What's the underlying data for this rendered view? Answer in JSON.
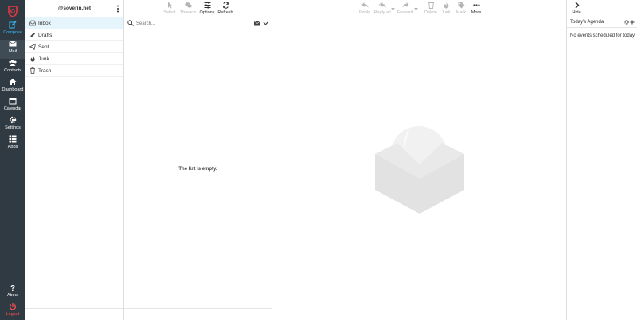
{
  "nav": {
    "items": [
      {
        "label": "Compose",
        "icon": "compose-icon"
      },
      {
        "label": "Mail",
        "icon": "mail-icon"
      },
      {
        "label": "Contacts",
        "icon": "contacts-icon"
      },
      {
        "label": "Dashboard",
        "icon": "home-icon"
      },
      {
        "label": "Calendar",
        "icon": "calendar-icon"
      },
      {
        "label": "Settings",
        "icon": "gear-icon"
      },
      {
        "label": "Apps",
        "icon": "grid-icon"
      },
      {
        "label": "About",
        "icon": "question-icon"
      },
      {
        "label": "Logout",
        "icon": "power-icon"
      }
    ],
    "active": "Mail",
    "accent_color": "#37beff",
    "logout_color": "#ff5252"
  },
  "folders": {
    "account": "@soverin.net",
    "items": [
      {
        "label": "Inbox",
        "icon": "inbox-icon"
      },
      {
        "label": "Drafts",
        "icon": "pencil-icon"
      },
      {
        "label": "Sent",
        "icon": "paper-plane-icon"
      },
      {
        "label": "Junk",
        "icon": "fire-icon"
      },
      {
        "label": "Trash",
        "icon": "trash-icon"
      }
    ],
    "selected": "Inbox"
  },
  "list": {
    "toolbar": [
      {
        "label": "Select",
        "icon": "pointer-icon",
        "enabled": false
      },
      {
        "label": "Threads",
        "icon": "comments-icon",
        "enabled": false
      },
      {
        "label": "Options",
        "icon": "sliders-icon",
        "enabled": true
      },
      {
        "label": "Refresh",
        "icon": "refresh-icon",
        "enabled": true
      }
    ],
    "search_placeholder": "Search...",
    "empty_message": "The list is empty."
  },
  "preview": {
    "toolbar": [
      {
        "label": "Reply",
        "icon": "reply-icon",
        "enabled": false
      },
      {
        "label": "Reply all",
        "icon": "reply-all-icon",
        "enabled": false
      },
      {
        "label": "Forward",
        "icon": "forward-icon",
        "enabled": false
      },
      {
        "label": "Delete",
        "icon": "trash-icon",
        "enabled": false
      },
      {
        "label": "Junk",
        "icon": "fire-icon",
        "enabled": false
      },
      {
        "label": "Mark",
        "icon": "tag-icon",
        "enabled": false
      },
      {
        "label": "More",
        "icon": "ellipsis-icon",
        "enabled": true
      }
    ]
  },
  "agenda": {
    "hide_label": "Hide",
    "title": "Today's Agenda",
    "empty_message": "No events scheduled for today."
  }
}
